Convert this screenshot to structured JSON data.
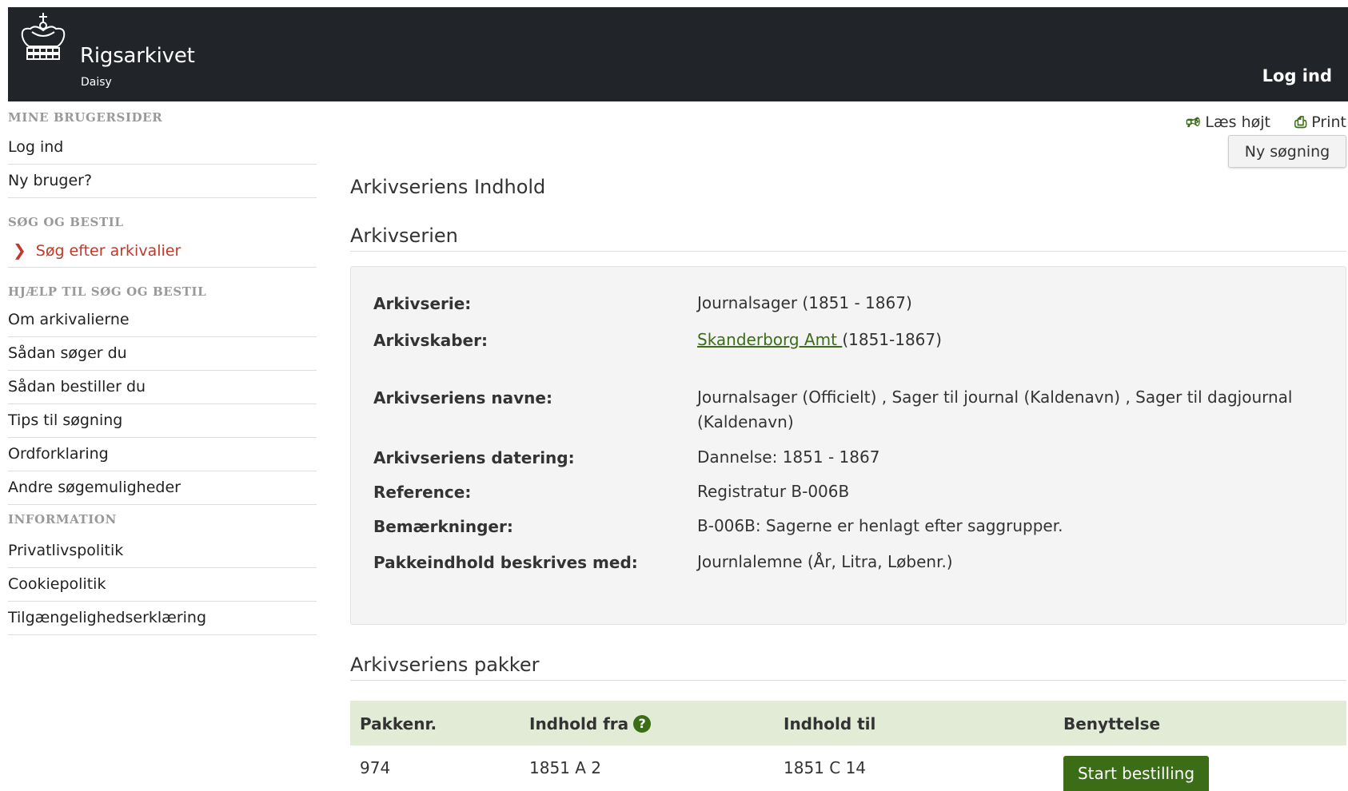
{
  "header": {
    "brand": "Rigsarkivet",
    "subbrand": "Daisy",
    "login": "Log ind"
  },
  "sidebar": {
    "sections": [
      {
        "heading": "MINE BRUGERSIDER",
        "items": [
          "Log ind",
          "Ny bruger?"
        ]
      },
      {
        "heading": "SØG OG BESTIL",
        "items": [
          "Søg efter arkivalier"
        ],
        "active_index": 0
      },
      {
        "heading": "HJÆLP TIL SØG OG BESTIL",
        "items": [
          "Om arkivalierne",
          "Sådan søger du",
          "Sådan bestiller du",
          "Tips til søgning",
          "Ordforklaring",
          "Andre søgemuligheder"
        ]
      },
      {
        "heading": "INFORMATION",
        "items": [
          "Privatlivspolitik",
          "Cookiepolitik",
          "Tilgængelighedserklæring"
        ]
      }
    ]
  },
  "toolbar": {
    "read_aloud": "Læs højt",
    "print": "Print",
    "new_search": "Ny søgning"
  },
  "main": {
    "page_title": "Arkivseriens Indhold",
    "series_section_title": "Arkivserien",
    "packages_section_title": "Arkivseriens pakker"
  },
  "series": {
    "arkivserie_label": "Arkivserie:",
    "arkivserie_value": "Journalsager (1851 - 1867)",
    "arkivskaber_label": "Arkivskaber:",
    "arkivskaber_link": "Skanderborg Amt ",
    "arkivskaber_years": "(1851-1867)",
    "navne_label": "Arkivseriens navne:",
    "navne_value": "Journalsager (Officielt) , Sager til journal (Kaldenavn) , Sager til dagjournal (Kaldenavn)",
    "datering_label": "Arkivseriens datering:",
    "datering_value": "Dannelse: 1851 - 1867",
    "reference_label": "Reference:",
    "reference_value": "Registratur B-006B",
    "bemaerkninger_label": "Bemærkninger:",
    "bemaerkninger_value": "B-006B: Sagerne er henlagt efter saggrupper.",
    "pakkeindhold_label": "Pakkeindhold beskrives med:",
    "pakkeindhold_value": "Journlalemne (År, Litra, Løbenr.)"
  },
  "table": {
    "headers": [
      "Pakkenr.",
      "Indhold fra",
      "Indhold til",
      "Benyttelse"
    ],
    "help_icon": "?",
    "rows": [
      {
        "pakkenr": "974",
        "fra": "1851 A 2",
        "til": "1851 C 14",
        "action": "Start bestilling"
      }
    ]
  }
}
